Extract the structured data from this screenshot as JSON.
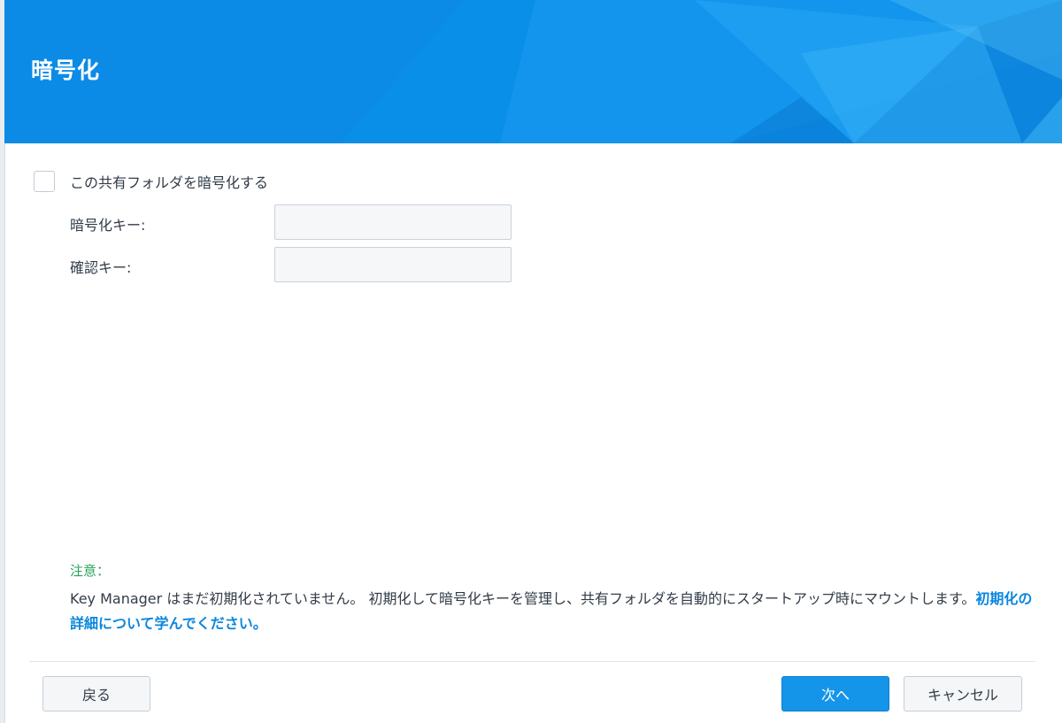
{
  "dialog": {
    "title": "暗号化"
  },
  "form": {
    "encrypt_checkbox_label": "この共有フォルダを暗号化する",
    "encrypt_checked": false,
    "encryption_key_label": "暗号化キー:",
    "encryption_key_value": "",
    "confirm_key_label": "確認キー:",
    "confirm_key_value": ""
  },
  "note": {
    "label": "注意：",
    "text": "Key Manager はまだ初期化されていません。 初期化して暗号化キーを管理し、共有フォルダを自動的にスタートアップ時にマウントします。",
    "link_text": "初期化の詳細について学んでください。"
  },
  "footer": {
    "back_label": "戻る",
    "next_label": "次へ",
    "cancel_label": "キャンセル"
  },
  "colors": {
    "header_blue": "#0a8fe8",
    "primary_button": "#1595ea",
    "note_label": "#26a259",
    "link": "#0a86de"
  }
}
